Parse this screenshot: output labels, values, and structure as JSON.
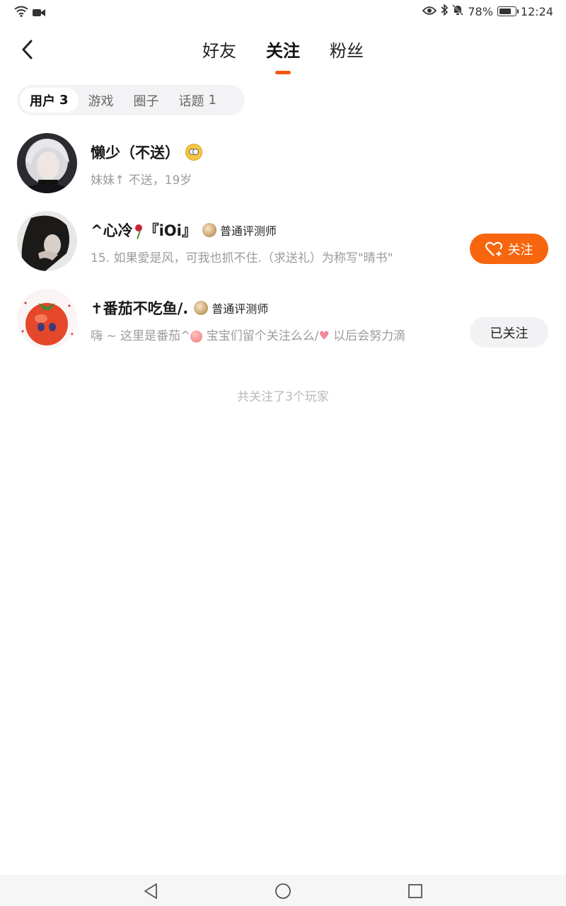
{
  "status_bar": {
    "battery_percent": "78%",
    "battery_level": 0.78,
    "time": "12:24",
    "icons": [
      "wifi-icon",
      "video-camera-icon",
      "eye-icon",
      "bluetooth-icon",
      "bell-off-icon",
      "battery-icon"
    ]
  },
  "header": {
    "tabs": [
      {
        "label": "好友",
        "active": false
      },
      {
        "label": "关注",
        "active": true
      },
      {
        "label": "粉丝",
        "active": false
      }
    ]
  },
  "category_tabs": [
    {
      "label": "用户",
      "count": "3",
      "active": true
    },
    {
      "label": "游戏",
      "count": "",
      "active": false
    },
    {
      "label": "圈子",
      "count": "",
      "active": false
    },
    {
      "label": "话题",
      "count": "1",
      "active": false
    }
  ],
  "users": [
    {
      "name": "懒少（不送）",
      "bio": "妹妹↑ 不送，19岁",
      "badge": "",
      "button": ""
    },
    {
      "name_prefix": "^心冷",
      "name_suffix": "『iOi』",
      "badge": "普通评测师",
      "bio": "15. 如果愛是风，可我也抓不住.（求送礼）为称写\"晴书\"",
      "button": "关注"
    },
    {
      "name": "✝番茄不吃鱼/.",
      "badge": "普通评测师",
      "bio_part1": "嗨 ~ 这里是番茄^",
      "bio_part2": " 宝宝们留个关注么么/",
      "bio_part3": " 以后会努力滴",
      "button": "已关注"
    }
  ],
  "footer_note": "共关注了3个玩家",
  "colors": {
    "accent": "#f7660e",
    "underline": "#f25a0a",
    "muted_text": "#9b9b9b"
  }
}
